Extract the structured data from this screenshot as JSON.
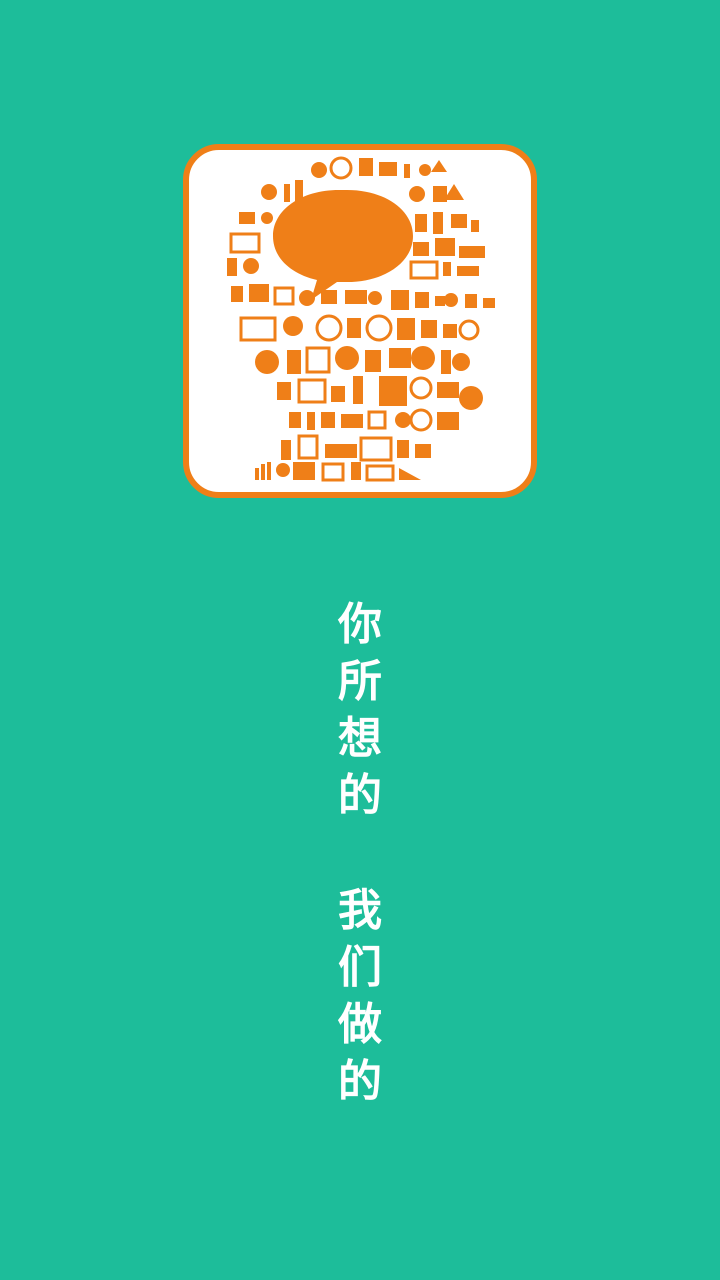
{
  "splash": {
    "logo_icon": "head-with-speech-bubble-icon",
    "colors": {
      "background": "#1dbd9a",
      "accent": "#ef7f18",
      "frame_fill": "#ffffff",
      "text": "#ffffff"
    },
    "slogan_line1": [
      "你",
      "所",
      "想",
      "的"
    ],
    "slogan_line2": [
      "我",
      "们",
      "做",
      "的"
    ]
  }
}
